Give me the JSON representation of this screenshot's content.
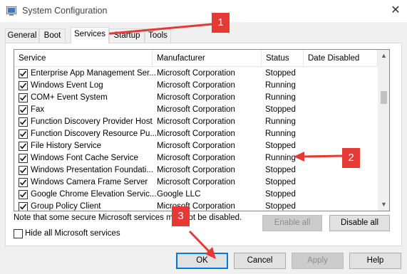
{
  "window": {
    "title": "System Configuration",
    "close_glyph": "✕"
  },
  "tabs": [
    {
      "label": "General",
      "active": false
    },
    {
      "label": "Boot",
      "active": false
    },
    {
      "label": "Services",
      "active": true
    },
    {
      "label": "Startup",
      "active": false
    },
    {
      "label": "Tools",
      "active": false
    }
  ],
  "list": {
    "columns": [
      "Service",
      "Manufacturer",
      "Status",
      "Date Disabled"
    ],
    "rows": [
      {
        "checked": true,
        "service": "Enterprise App Management Ser...",
        "manufacturer": "Microsoft Corporation",
        "status": "Stopped",
        "date_disabled": ""
      },
      {
        "checked": true,
        "service": "Windows Event Log",
        "manufacturer": "Microsoft Corporation",
        "status": "Running",
        "date_disabled": ""
      },
      {
        "checked": true,
        "service": "COM+ Event System",
        "manufacturer": "Microsoft Corporation",
        "status": "Running",
        "date_disabled": ""
      },
      {
        "checked": true,
        "service": "Fax",
        "manufacturer": "Microsoft Corporation",
        "status": "Stopped",
        "date_disabled": ""
      },
      {
        "checked": true,
        "service": "Function Discovery Provider Host",
        "manufacturer": "Microsoft Corporation",
        "status": "Running",
        "date_disabled": ""
      },
      {
        "checked": true,
        "service": "Function Discovery Resource Pu...",
        "manufacturer": "Microsoft Corporation",
        "status": "Running",
        "date_disabled": ""
      },
      {
        "checked": true,
        "service": "File History Service",
        "manufacturer": "Microsoft Corporation",
        "status": "Stopped",
        "date_disabled": ""
      },
      {
        "checked": true,
        "service": "Windows Font Cache Service",
        "manufacturer": "Microsoft Corporation",
        "status": "Running",
        "date_disabled": ""
      },
      {
        "checked": true,
        "service": "Windows Presentation Foundati...",
        "manufacturer": "Microsoft Corporation",
        "status": "Stopped",
        "date_disabled": ""
      },
      {
        "checked": true,
        "service": "Windows Camera Frame Server",
        "manufacturer": "Microsoft Corporation",
        "status": "Stopped",
        "date_disabled": ""
      },
      {
        "checked": true,
        "service": "Google Chrome Elevation Servic...",
        "manufacturer": "Google LLC",
        "status": "Stopped",
        "date_disabled": ""
      },
      {
        "checked": true,
        "service": "Group Policy Client",
        "manufacturer": "Microsoft Corporation",
        "status": "Stopped",
        "date_disabled": ""
      }
    ],
    "scroll_up_glyph": "▲",
    "scroll_down_glyph": "▼"
  },
  "note": "Note that some secure Microsoft services may not be disabled.",
  "buttons": {
    "enable_all": "Enable all",
    "disable_all": "Disable all",
    "ok": "OK",
    "cancel": "Cancel",
    "apply": "Apply",
    "help": "Help"
  },
  "hide_all": {
    "label": "Hide all Microsoft services",
    "checked": false
  },
  "annotations": {
    "one": "1",
    "two": "2",
    "three": "3"
  },
  "colors": {
    "annotation": "#e53935",
    "accent": "#0078d7"
  }
}
